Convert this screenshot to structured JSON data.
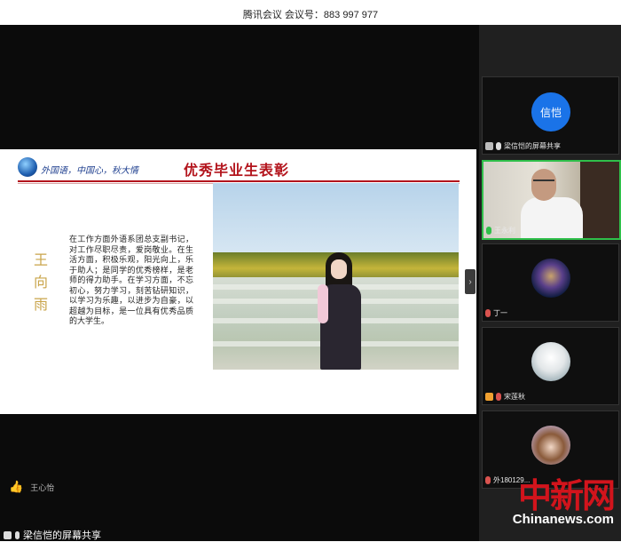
{
  "app": {
    "meeting_title": "腾讯会议 会议号：883 997 977"
  },
  "slide": {
    "motto": "外国语，中国心，秋大情",
    "title": "优秀毕业生表彰",
    "name_vertical": "王向雨",
    "text": "在工作方面外语系团总支副书记，对工作尽职尽责，爱岗敬业。在生活方面，积极乐观，阳光向上，乐于助人；是同学的优秀榜样，是老师的得力助手。在学习方面，不忘初心，努力学习，刻苦钻研知识，以学习为乐趣，以进步为自豪，以超越为目标，是一位具有优秀品质的大学生。"
  },
  "participants": [
    {
      "avatar_text": "信恺",
      "label": "梁信恺的屏幕共享"
    },
    {
      "label": "王永利"
    },
    {
      "label": "丁一"
    },
    {
      "label": "宋莲秋"
    },
    {
      "label": "外180129..."
    }
  ],
  "bottom": {
    "speaker": "王心怡",
    "share_label": "梁信恺的屏幕共享"
  },
  "watermark": {
    "cn": "中新网",
    "en": "Chinanews.com"
  },
  "colors": {
    "accent_red": "#b3141c",
    "active_green": "#2fbf4a",
    "avatar_blue": "#1a73e8"
  }
}
